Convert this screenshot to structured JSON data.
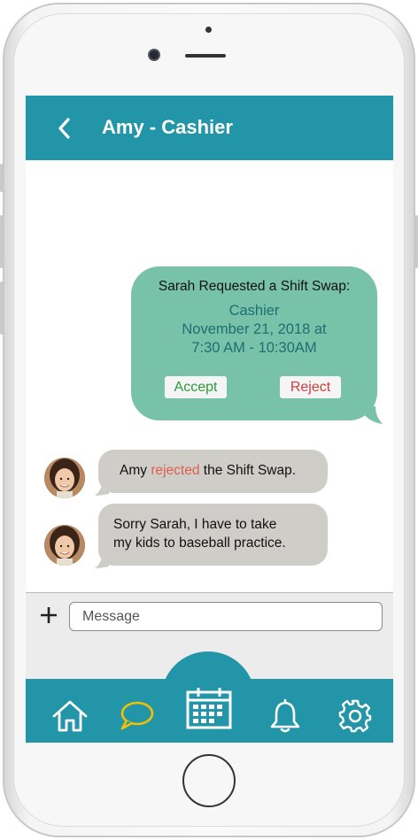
{
  "header": {
    "title": "Amy - Cashier"
  },
  "outgoing": {
    "title": "Sarah Requested a Shift Swap:",
    "role": "Cashier",
    "date": "November 21, 2018 at",
    "time": "7:30 AM - 10:30AM",
    "accept_label": "Accept",
    "reject_label": "Reject"
  },
  "incoming": [
    {
      "before": "Amy ",
      "highlight": "rejected",
      "after": " the Shift Swap."
    },
    {
      "line1": "Sorry Sarah, I have to take",
      "line2": "my kids to baseball practice."
    }
  ],
  "composer": {
    "placeholder": "Message"
  },
  "nav": [
    "home-icon",
    "chat-icon",
    "calendar-icon",
    "bell-icon",
    "gear-icon"
  ],
  "colors": {
    "header": "#2395a8",
    "outgoing_bubble": "#78c2a9",
    "incoming_bubble": "#cfcdc8",
    "accept": "#2e9a3c",
    "reject": "#d23c3c",
    "chat_active": "#f2c200"
  }
}
